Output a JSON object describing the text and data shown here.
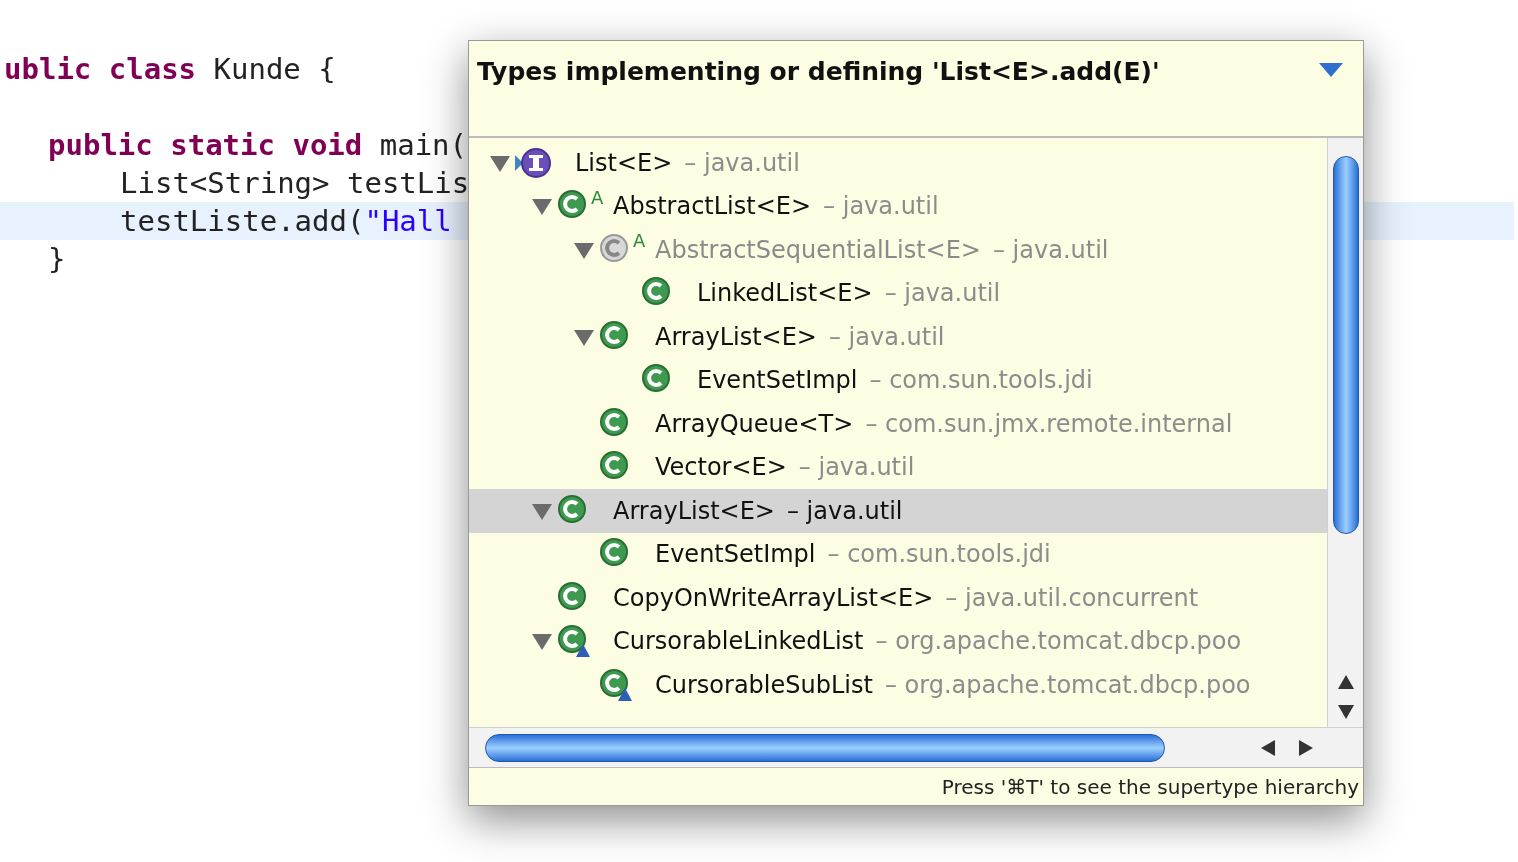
{
  "editor": {
    "lines": [
      {
        "highlighted": false,
        "tokens": [
          {
            "kind": "keyword",
            "text": "ublic class"
          },
          {
            "kind": "plain",
            "text": " Kunde {"
          }
        ],
        "children": [
          {
            "highlighted": false,
            "tokens": [
              {
                "kind": "keyword",
                "text": "public static void"
              },
              {
                "kind": "plain",
                "text": " main("
              }
            ],
            "children": [
              {
                "highlighted": false,
                "tokens": [
                  {
                    "kind": "plain",
                    "text": "List<String> testLis"
                  }
                ]
              },
              {
                "highlighted": true,
                "tokens": [
                  {
                    "kind": "plain",
                    "text": "testListe.add("
                  },
                  {
                    "kind": "string",
                    "text": "\"Hall"
                  }
                ]
              }
            ]
          },
          {
            "highlighted": false,
            "tokens": [
              {
                "kind": "plain",
                "text": "}"
              }
            ]
          }
        ]
      }
    ]
  },
  "popup": {
    "title": "Types implementing or defining 'List<E>.add(E)'",
    "tree": [
      {
        "name": "List<E>",
        "package": "– java.util",
        "kind": "interface",
        "expanded": true,
        "selected": false,
        "greyed": false,
        "children": [
          {
            "name": "AbstractList<E>",
            "package": "– java.util",
            "kind": "class",
            "badge": "A",
            "expanded": true,
            "selected": false,
            "greyed": false,
            "children": [
              {
                "name": "AbstractSequentialList<E>",
                "package": "– java.util",
                "kind": "class",
                "badge": "A",
                "expanded": true,
                "selected": false,
                "greyed": true,
                "children": [
                  {
                    "name": "LinkedList<E>",
                    "package": "– java.util",
                    "kind": "class",
                    "selected": false,
                    "greyed": false
                  }
                ]
              },
              {
                "name": "ArrayList<E>",
                "package": "– java.util",
                "kind": "class",
                "expanded": true,
                "selected": false,
                "greyed": false,
                "children": [
                  {
                    "name": "EventSetImpl",
                    "package": "– com.sun.tools.jdi",
                    "kind": "class",
                    "selected": false,
                    "greyed": false
                  }
                ]
              },
              {
                "name": "ArrayQueue<T>",
                "package": "– com.sun.jmx.remote.internal",
                "kind": "class",
                "selected": false,
                "greyed": false
              },
              {
                "name": "Vector<E>",
                "package": "– java.util",
                "kind": "class",
                "selected": false,
                "greyed": false
              }
            ]
          },
          {
            "name": "ArrayList<E>",
            "package": "– java.util",
            "kind": "class",
            "expanded": true,
            "selected": true,
            "greyed": false,
            "children": [
              {
                "name": "EventSetImpl",
                "package": "– com.sun.tools.jdi",
                "kind": "class",
                "selected": false,
                "greyed": false
              }
            ]
          },
          {
            "name": "CopyOnWriteArrayList<E>",
            "package": "– java.util.concurrent",
            "kind": "class",
            "selected": false,
            "greyed": false
          },
          {
            "name": "CursorableLinkedList",
            "package": "– org.apache.tomcat.dbcp.poo",
            "kind": "package-class",
            "expanded": true,
            "selected": false,
            "greyed": false,
            "children": [
              {
                "name": "CursorableSubList",
                "package": "– org.apache.tomcat.dbcp.poo",
                "kind": "package-class",
                "selected": false,
                "greyed": false
              }
            ]
          }
        ]
      }
    ],
    "hint": "Press '⌘T' to see the supertype hierarchy"
  }
}
